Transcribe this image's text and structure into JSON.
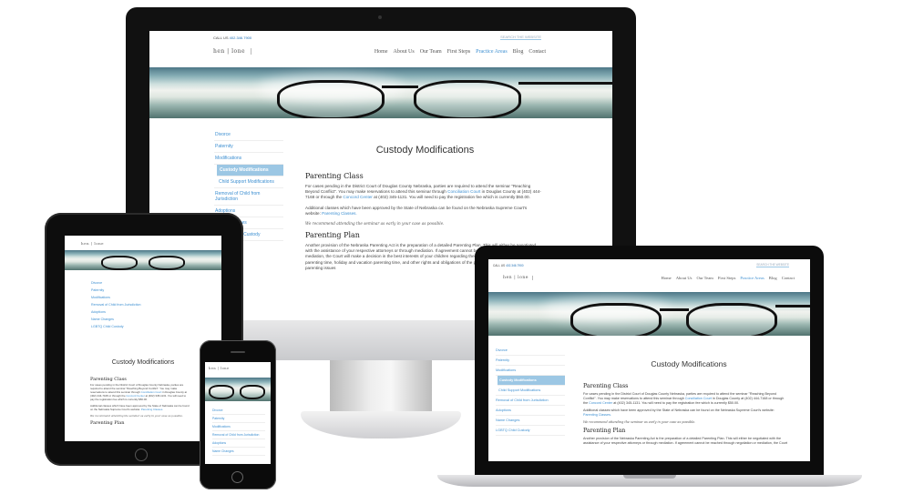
{
  "site": {
    "phone_label": "CALL US",
    "phone_number": "402.346.7900",
    "search_placeholder": "SEARCH THE WEBSITE",
    "logo_text": "hen | lone",
    "menu": [
      "Home",
      "About Us",
      "Our Team",
      "First Steps",
      "Practice Areas",
      "Blog",
      "Contact"
    ],
    "active_menu": "Practice Areas",
    "sidebar": [
      "Divorce",
      "Paternity",
      "Modifications",
      "Custody Modifications",
      "Child Support Modifications",
      "Removal of Child from Jurisdiction",
      "Adoptions",
      "Name Changes",
      "LGBTQ Child Custody"
    ],
    "active_sidebar": "Custody Modifications",
    "page_title": "Custody Modifications",
    "section1_heading": "Parenting Class",
    "section1_p1_a": "For cases pending in the District Court of Douglas County Nebraska, parties are required to attend the seminar \"Reaching Beyond Conflict\". You may make reservations to attend this seminar through",
    "conciliation_link": "Conciliation Court",
    "section1_p1_b": "in Douglas County at (402) 444-7168 or through the",
    "concord_link": "Concord Center",
    "section1_p1_c": "at (402) 345-1131.  You will need to pay the registration fee which is currently $50.00.",
    "section1_p2_a": "Additional classes which have been approved by the State of Nebraska can be found on the Nebraska Supreme Court's website:",
    "parenting_classes_link": "Parenting Classes.",
    "note": "We recommend attending the seminar as early in your case as possible.",
    "section2_heading": "Parenting Plan",
    "section2_p": "Another provision of the Nebraska Parenting Act is the preparation of a detailed Parenting Plan. This will either be negotiated with the assistance of your respective attorneys or through mediation. If agreement cannot be reached through negotiation or mediation, the Court will make a decision in the best interests of your children regarding their legal and physical custody, parenting time, holiday and vacation parenting time, and other rights and obligations of the parents. Below are some of the parenting issues"
  },
  "colors": {
    "accent": "#3d8fd1",
    "sidebar_active_bg": "#9cc7e4"
  }
}
